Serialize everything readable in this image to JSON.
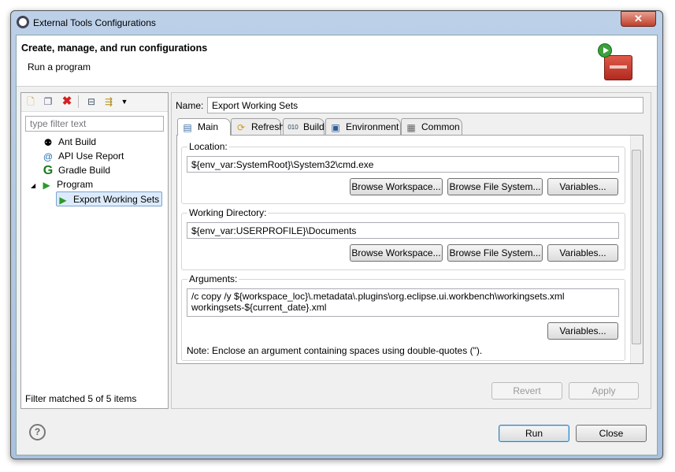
{
  "window": {
    "title": "External Tools Configurations",
    "close": "✕"
  },
  "header": {
    "title": "Create, manage, and run configurations",
    "subtitle": "Run a program"
  },
  "left": {
    "filter_placeholder": "type filter text",
    "tree": [
      {
        "label": "Ant Build",
        "icon": "ant-icon"
      },
      {
        "label": "API Use Report",
        "icon": "api-report-icon"
      },
      {
        "label": "Gradle Build",
        "icon": "gradle-icon"
      },
      {
        "label": "Program",
        "icon": "program-icon",
        "expanded": true
      },
      {
        "label": "Export Working Sets",
        "icon": "program-icon",
        "selected": true
      }
    ],
    "status": "Filter matched 5 of 5 items"
  },
  "config": {
    "name_label": "Name:",
    "name_value": "Export Working Sets",
    "tabs": [
      {
        "label": "Main",
        "active": true
      },
      {
        "label": "Refresh"
      },
      {
        "label": "Build"
      },
      {
        "label": "Environment"
      },
      {
        "label": "Common"
      }
    ],
    "location": {
      "label": "Location:",
      "value": "${env_var:SystemRoot}\\System32\\cmd.exe"
    },
    "workdir": {
      "label": "Working Directory:",
      "value": "${env_var:USERPROFILE}\\Documents"
    },
    "arguments": {
      "label": "Arguments:",
      "line1": "/c copy /y ${workspace_loc}\\.metadata\\.plugins\\org.eclipse.ui.workbench\\workingsets.xml",
      "line2": "workingsets-${current_date}.xml",
      "note": "Note: Enclose an argument containing spaces using double-quotes (\")."
    },
    "browse_workspace": "Browse Workspace...",
    "browse_fs": "Browse File System...",
    "variables": "Variables...",
    "revert": "Revert",
    "apply": "Apply"
  },
  "footer": {
    "help": "?",
    "run": "Run",
    "close": "Close"
  }
}
